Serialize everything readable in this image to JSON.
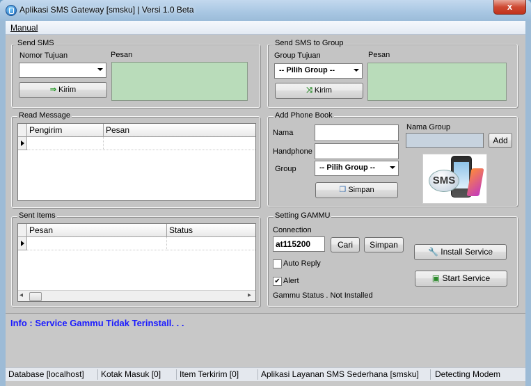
{
  "window": {
    "title": "Aplikasi SMS Gateway [smsku] | Versi 1.0 Beta",
    "close_label": "x"
  },
  "menu": {
    "manual": "Manual"
  },
  "send_sms": {
    "legend": "Send SMS",
    "nomor_label": "Nomor Tujuan",
    "pesan_label": "Pesan",
    "kirim_label": "Kirim"
  },
  "send_group": {
    "legend": "Send SMS to Group",
    "group_label": "Group Tujuan",
    "pesan_label": "Pesan",
    "group_selected": "-- Pilih Group --",
    "kirim_label": "Kirim"
  },
  "read_message": {
    "legend": "Read Message",
    "columns": [
      "Pengirim",
      "Pesan"
    ]
  },
  "phone_book": {
    "legend": "Add Phone Book",
    "nama_label": "Nama",
    "handphone_label": "Handphone",
    "group_label": "Group",
    "group_selected": "-- Pilih Group --",
    "simpan_label": "Simpan",
    "nama_group_label": "Nama Group",
    "add_label": "Add",
    "image_text": "SMS"
  },
  "sent_items": {
    "legend": "Sent Items",
    "columns": [
      "Pesan",
      "Status"
    ],
    "scroll_left": "◂",
    "scroll_right": "▸"
  },
  "gammu": {
    "legend": "Setting GAMMU",
    "connection_label": "Connection",
    "connection_value": "at115200",
    "cari_label": "Cari",
    "simpan_label": "Simpan",
    "install_label": "Install Service",
    "start_label": "Start Service",
    "auto_reply_label": "Auto Reply",
    "auto_reply_checked": false,
    "alert_label": "Alert",
    "alert_checked": true,
    "status_text": "Gammu Status .  Not Installed"
  },
  "info": {
    "text": "Info : Service Gammu Tidak Terinstall. . ."
  },
  "statusbar": {
    "database": "Database [localhost]",
    "kotak_masuk": "Kotak Masuk [0]",
    "item_terkirim": "Item Terkirim [0]",
    "aplikasi": "Aplikasi Layanan SMS Sederhana [smsku]",
    "modem": "Detecting Modem"
  },
  "colors": {
    "info_text": "#1a1aff",
    "green_box": "#b9dcba",
    "form_bg": "#c4c4c4"
  }
}
